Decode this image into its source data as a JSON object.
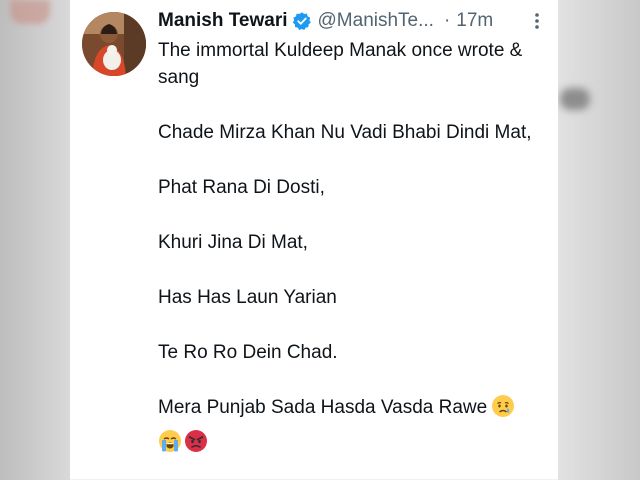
{
  "tweet": {
    "author_name": "Manish Tewari",
    "author_handle": "@ManishTe...",
    "separator": "·",
    "timestamp": "17m",
    "paragraphs": [
      "The immortal Kuldeep Manak once wrote & sang",
      "Chade Mirza Khan Nu Vadi Bhabi Dindi Mat,",
      "Phat Rana Di Dosti,",
      "Khuri Jina Di Mat,",
      "Has Has Laun Yarian",
      "Te Ro Ro Dein Chad."
    ],
    "last_paragraph": "Mera Punjab Sada Hasda Vasda Rawe",
    "emojis": [
      "crying-face-emoji",
      "loudly-crying-face-emoji",
      "angry-face-emoji"
    ]
  },
  "colors": {
    "verified": "#1d9bf0",
    "text_primary": "#0f1419",
    "text_secondary": "#536471"
  }
}
